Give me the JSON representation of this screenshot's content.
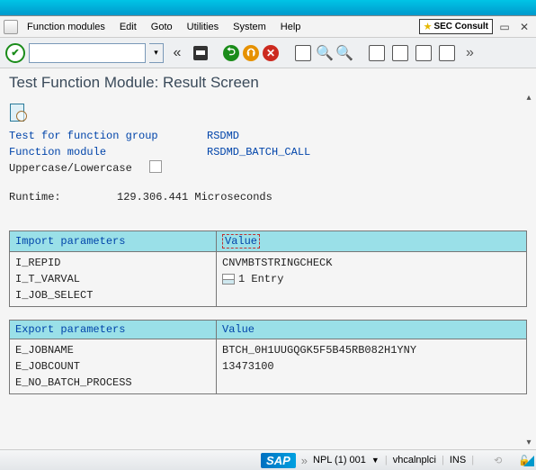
{
  "menu": {
    "items": [
      "Function modules",
      "Edit",
      "Goto",
      "Utilities",
      "System",
      "Help"
    ]
  },
  "watermark_brand": "SEC Consult",
  "title": "Test Function Module: Result Screen",
  "info": {
    "test_for_label": "Test for function group",
    "test_for_value": "RSDMD",
    "fm_label": "Function module",
    "fm_value": "RSDMD_BATCH_CALL",
    "case_label": "Uppercase/Lowercase",
    "runtime_label": "Runtime:",
    "runtime_value": "129.306.441 Microseconds"
  },
  "import": {
    "header_param": "Import parameters",
    "header_val": "Value",
    "rows": [
      "I_REPID",
      "I_T_VARVAL",
      "I_JOB_SELECT"
    ],
    "val0": "CNVMBTSTRINGCHECK",
    "val1": "1 Entry"
  },
  "export": {
    "header_param": "Export parameters",
    "header_val": "Value",
    "rows": [
      "E_JOBNAME",
      "E_JOBCOUNT",
      "E_NO_BATCH_PROCESS"
    ],
    "val0": "BTCH_0H1UUGQGK5F5B45RB082H1YNY",
    "val1": "13473100"
  },
  "status": {
    "sap": "SAP",
    "client": "NPL (1) 001",
    "host": "vhcalnplci",
    "mode": "INS"
  }
}
